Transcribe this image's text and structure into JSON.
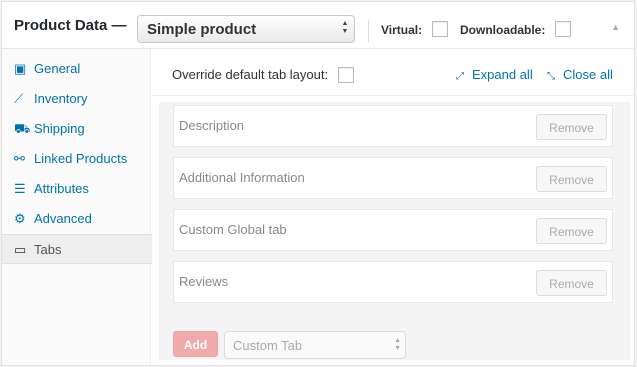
{
  "header": {
    "title": "Product Data —",
    "product_type": "Simple product",
    "virtual_label": "Virtual:",
    "downloadable_label": "Downloadable:",
    "toggle_icon": "triangle-up-icon"
  },
  "sidebar": {
    "items": [
      {
        "label": "General",
        "icon": "wrench-icon",
        "active": false
      },
      {
        "label": "Inventory",
        "icon": "chart-line-icon",
        "active": false
      },
      {
        "label": "Shipping",
        "icon": "truck-icon",
        "active": false
      },
      {
        "label": "Linked Products",
        "icon": "link-icon",
        "active": false
      },
      {
        "label": "Attributes",
        "icon": "list-icon",
        "active": false
      },
      {
        "label": "Advanced",
        "icon": "gear-icon",
        "active": false
      },
      {
        "label": "Tabs",
        "icon": "window-icon",
        "active": true
      }
    ]
  },
  "toolbar": {
    "override_label": "Override default tab layout:",
    "expand_all": "Expand all",
    "close_all": "Close all"
  },
  "tabs": {
    "rows": [
      {
        "title": "Description",
        "button": "Remove"
      },
      {
        "title": "Additional Information",
        "button": "Remove"
      },
      {
        "title": "Custom Global tab",
        "button": "Remove"
      },
      {
        "title": "Reviews",
        "button": "Remove"
      }
    ],
    "add_button": "Add",
    "select_value": "Custom Tab"
  },
  "colors": {
    "link": "#0073aa",
    "add_button": "#f0aaaa"
  }
}
